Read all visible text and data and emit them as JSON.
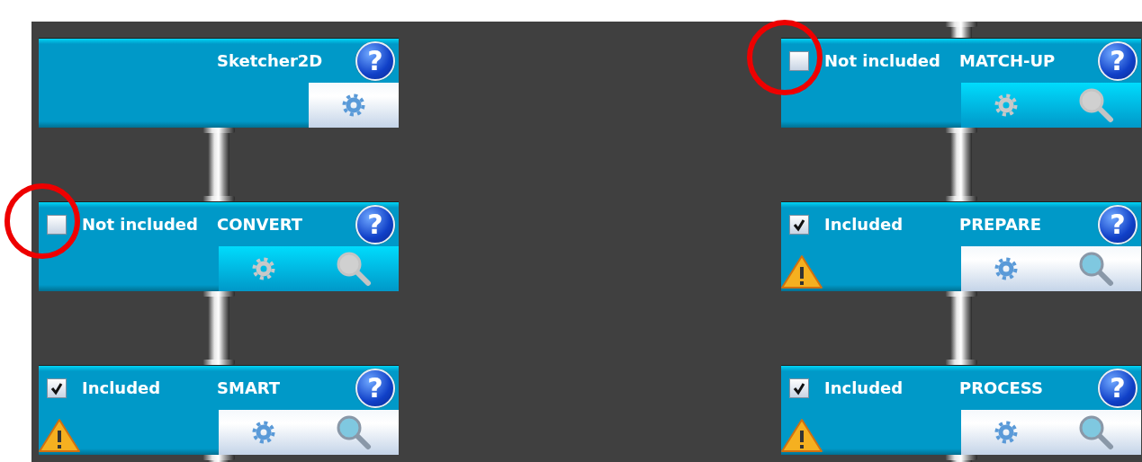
{
  "columns": [
    {
      "pipe_above": false,
      "pipe_below": true,
      "cards": [
        {
          "title": "Sketcher2D",
          "help": "?",
          "warning": false,
          "tools": [
            {
              "kind": "settings"
            }
          ],
          "tools_enabled": true,
          "circled": false
        },
        {
          "title": "CONVERT",
          "included": false,
          "status": "Not included",
          "help": "?",
          "warning": false,
          "tools": [
            {
              "kind": "settings"
            },
            {
              "kind": "search"
            }
          ],
          "tools_enabled": false,
          "circled": true
        },
        {
          "title": "SMART",
          "included": true,
          "status": "Included",
          "help": "?",
          "warning": true,
          "tools": [
            {
              "kind": "settings"
            },
            {
              "kind": "search"
            }
          ],
          "tools_enabled": true,
          "circled": false
        }
      ]
    },
    {
      "pipe_above": true,
      "pipe_below": true,
      "cards": [
        {
          "title": "MATCH-UP",
          "included": false,
          "status": "Not included",
          "help": "?",
          "warning": false,
          "tools": [
            {
              "kind": "settings"
            },
            {
              "kind": "search"
            }
          ],
          "tools_enabled": false,
          "circled": true
        },
        {
          "title": "PREPARE",
          "included": true,
          "status": "Included",
          "help": "?",
          "warning": true,
          "tools": [
            {
              "kind": "settings"
            },
            {
              "kind": "search"
            }
          ],
          "tools_enabled": true,
          "circled": false
        },
        {
          "title": "PROCESS",
          "included": true,
          "status": "Included",
          "help": "?",
          "warning": true,
          "tools": [
            {
              "kind": "settings"
            },
            {
              "kind": "search"
            }
          ],
          "tools_enabled": true,
          "circled": false
        }
      ]
    }
  ]
}
